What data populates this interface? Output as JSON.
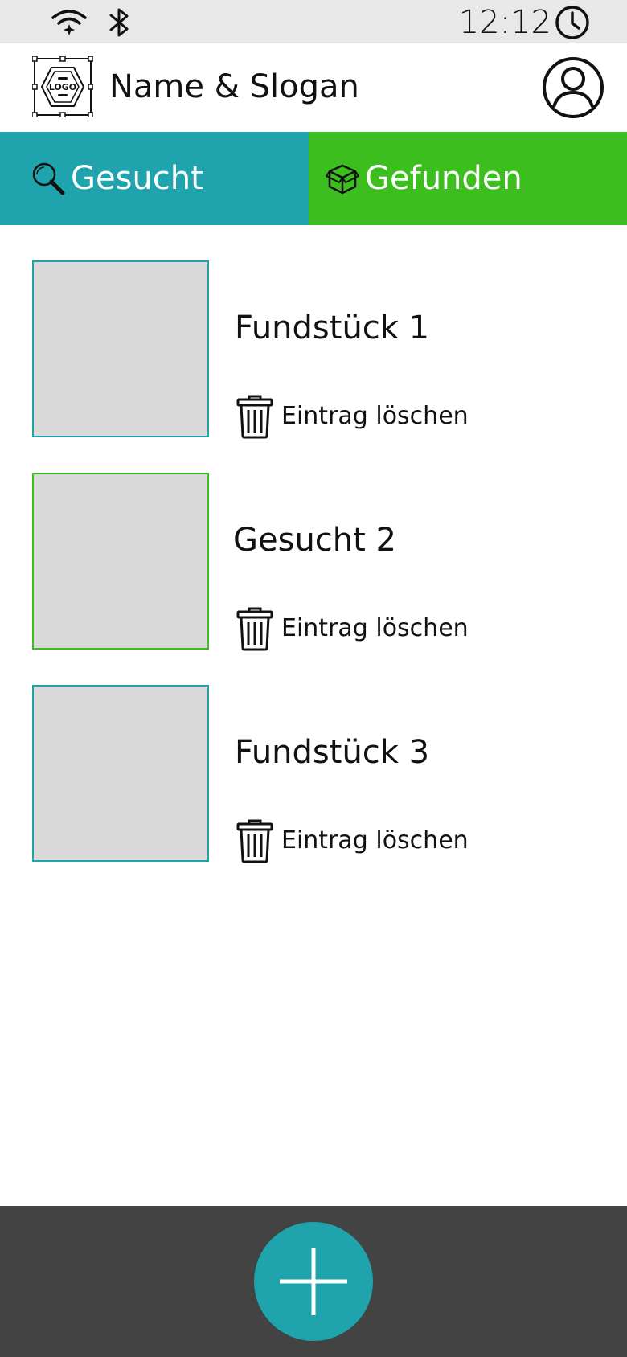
{
  "status_bar": {
    "time": "12:12",
    "icons": [
      "wifi-icon",
      "bluetooth-icon",
      "clock-icon"
    ]
  },
  "header": {
    "logo_text": "LOGO",
    "title": "Name & Slogan",
    "profile_icon": "user-circle-icon"
  },
  "tabs": [
    {
      "label": "Gesucht",
      "icon": "search-icon",
      "color": "#1fa3ad"
    },
    {
      "label": "Gefunden",
      "icon": "box-icon",
      "color": "#3cbe1e"
    }
  ],
  "items": [
    {
      "title": "Fundstück 1",
      "delete_label": "Eintrag löschen",
      "border_color": "#1fa3ad"
    },
    {
      "title": "Gesucht 2",
      "delete_label": "Eintrag löschen",
      "border_color": "#3cbe1e"
    },
    {
      "title": "Fundstück 3",
      "delete_label": "Eintrag löschen",
      "border_color": "#1fa3ad"
    }
  ],
  "colors": {
    "primary": "#1fa3ad",
    "accent": "#3cbe1e",
    "bottom_bar": "#434343",
    "thumbnail": "#d9d9d9"
  },
  "bottom_bar": {
    "fab_icon": "plus-icon"
  }
}
